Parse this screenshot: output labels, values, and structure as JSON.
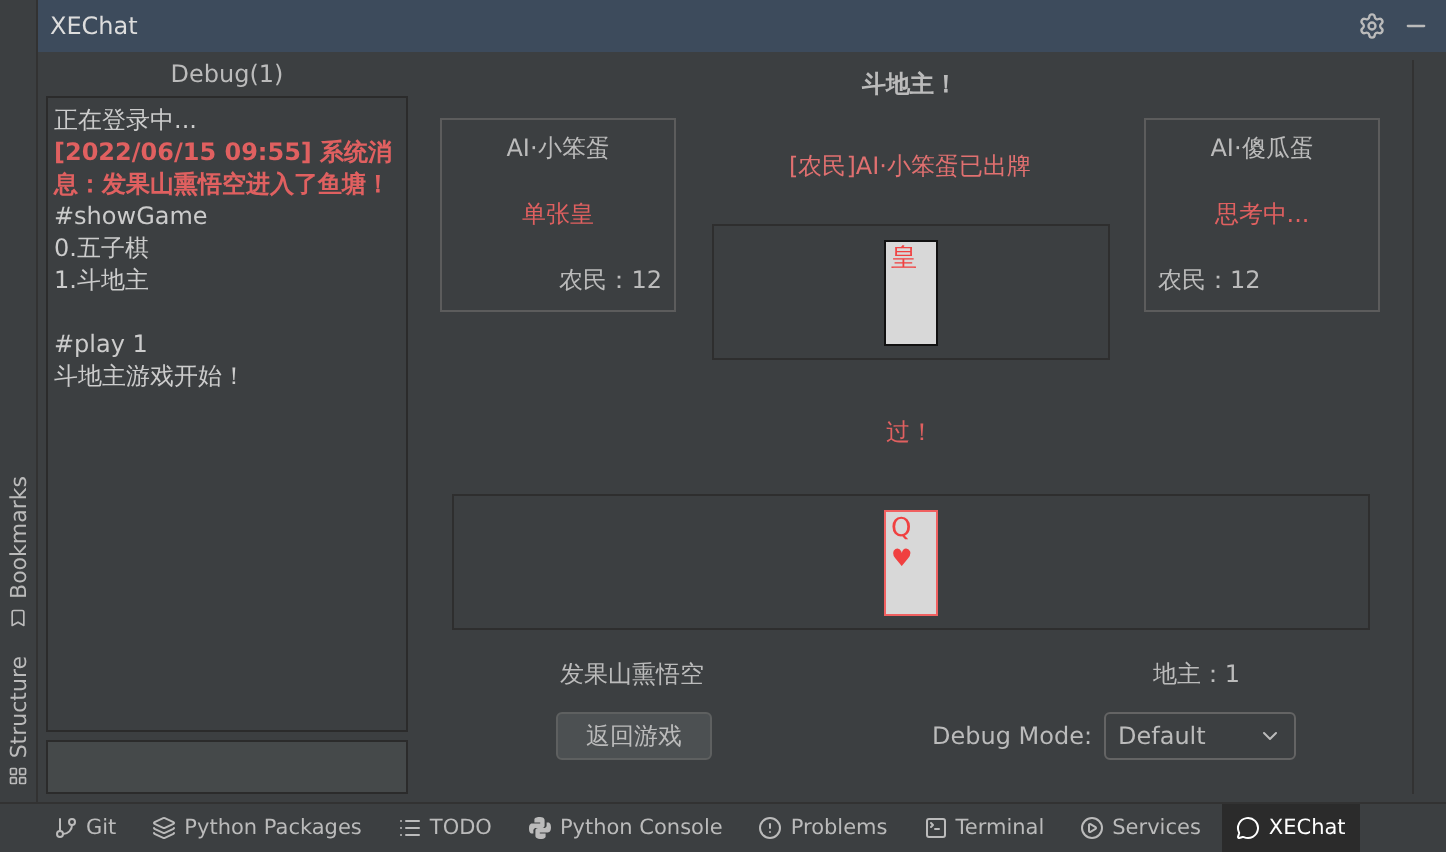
{
  "window": {
    "title": "XEChat"
  },
  "side_tools": [
    {
      "label": "Bookmarks"
    },
    {
      "label": "Structure"
    }
  ],
  "debug": {
    "title": "Debug(1)",
    "log_blocks": [
      [
        {
          "text": "正在登录中...",
          "kind": "normal"
        },
        {
          "text": "[2022/06/15 09:55] 系统消息：发果山熏悟空进入了鱼塘！",
          "kind": "system"
        },
        {
          "text": "#showGame",
          "kind": "normal"
        },
        {
          "text": "0.五子棋",
          "kind": "normal"
        },
        {
          "text": "1.斗地主",
          "kind": "normal"
        }
      ],
      [
        {
          "text": "#play 1",
          "kind": "normal"
        },
        {
          "text": "斗地主游戏开始！",
          "kind": "normal"
        }
      ]
    ]
  },
  "game": {
    "title": "斗地主！",
    "left_player": {
      "name": "AI·小笨蛋",
      "status": "单张皇",
      "count": "农民：12"
    },
    "message": "[农民]AI·小笨蛋已出牌",
    "right_player": {
      "name": "AI·傻瓜蛋",
      "status": "思考中...",
      "count": "农民：12"
    },
    "played_cards": [
      {
        "rank": "皇"
      }
    ],
    "pass_text": "过！",
    "hand_cards": [
      {
        "rank": "Q",
        "suit": "♥"
      }
    ],
    "player_name": "发果山熏悟空",
    "player_count": "地主：1",
    "back_button": "返回游戏",
    "debug_mode": {
      "label": "Debug Mode:",
      "value": "Default"
    }
  },
  "tool_bar": [
    {
      "label": "Git",
      "selected": false
    },
    {
      "label": "Python Packages",
      "selected": false
    },
    {
      "label": "TODO",
      "selected": false
    },
    {
      "label": "Python Console",
      "selected": false
    },
    {
      "label": "Problems",
      "selected": false
    },
    {
      "label": "Terminal",
      "selected": false
    },
    {
      "label": "Services",
      "selected": false
    },
    {
      "label": "XEChat",
      "selected": true
    }
  ]
}
